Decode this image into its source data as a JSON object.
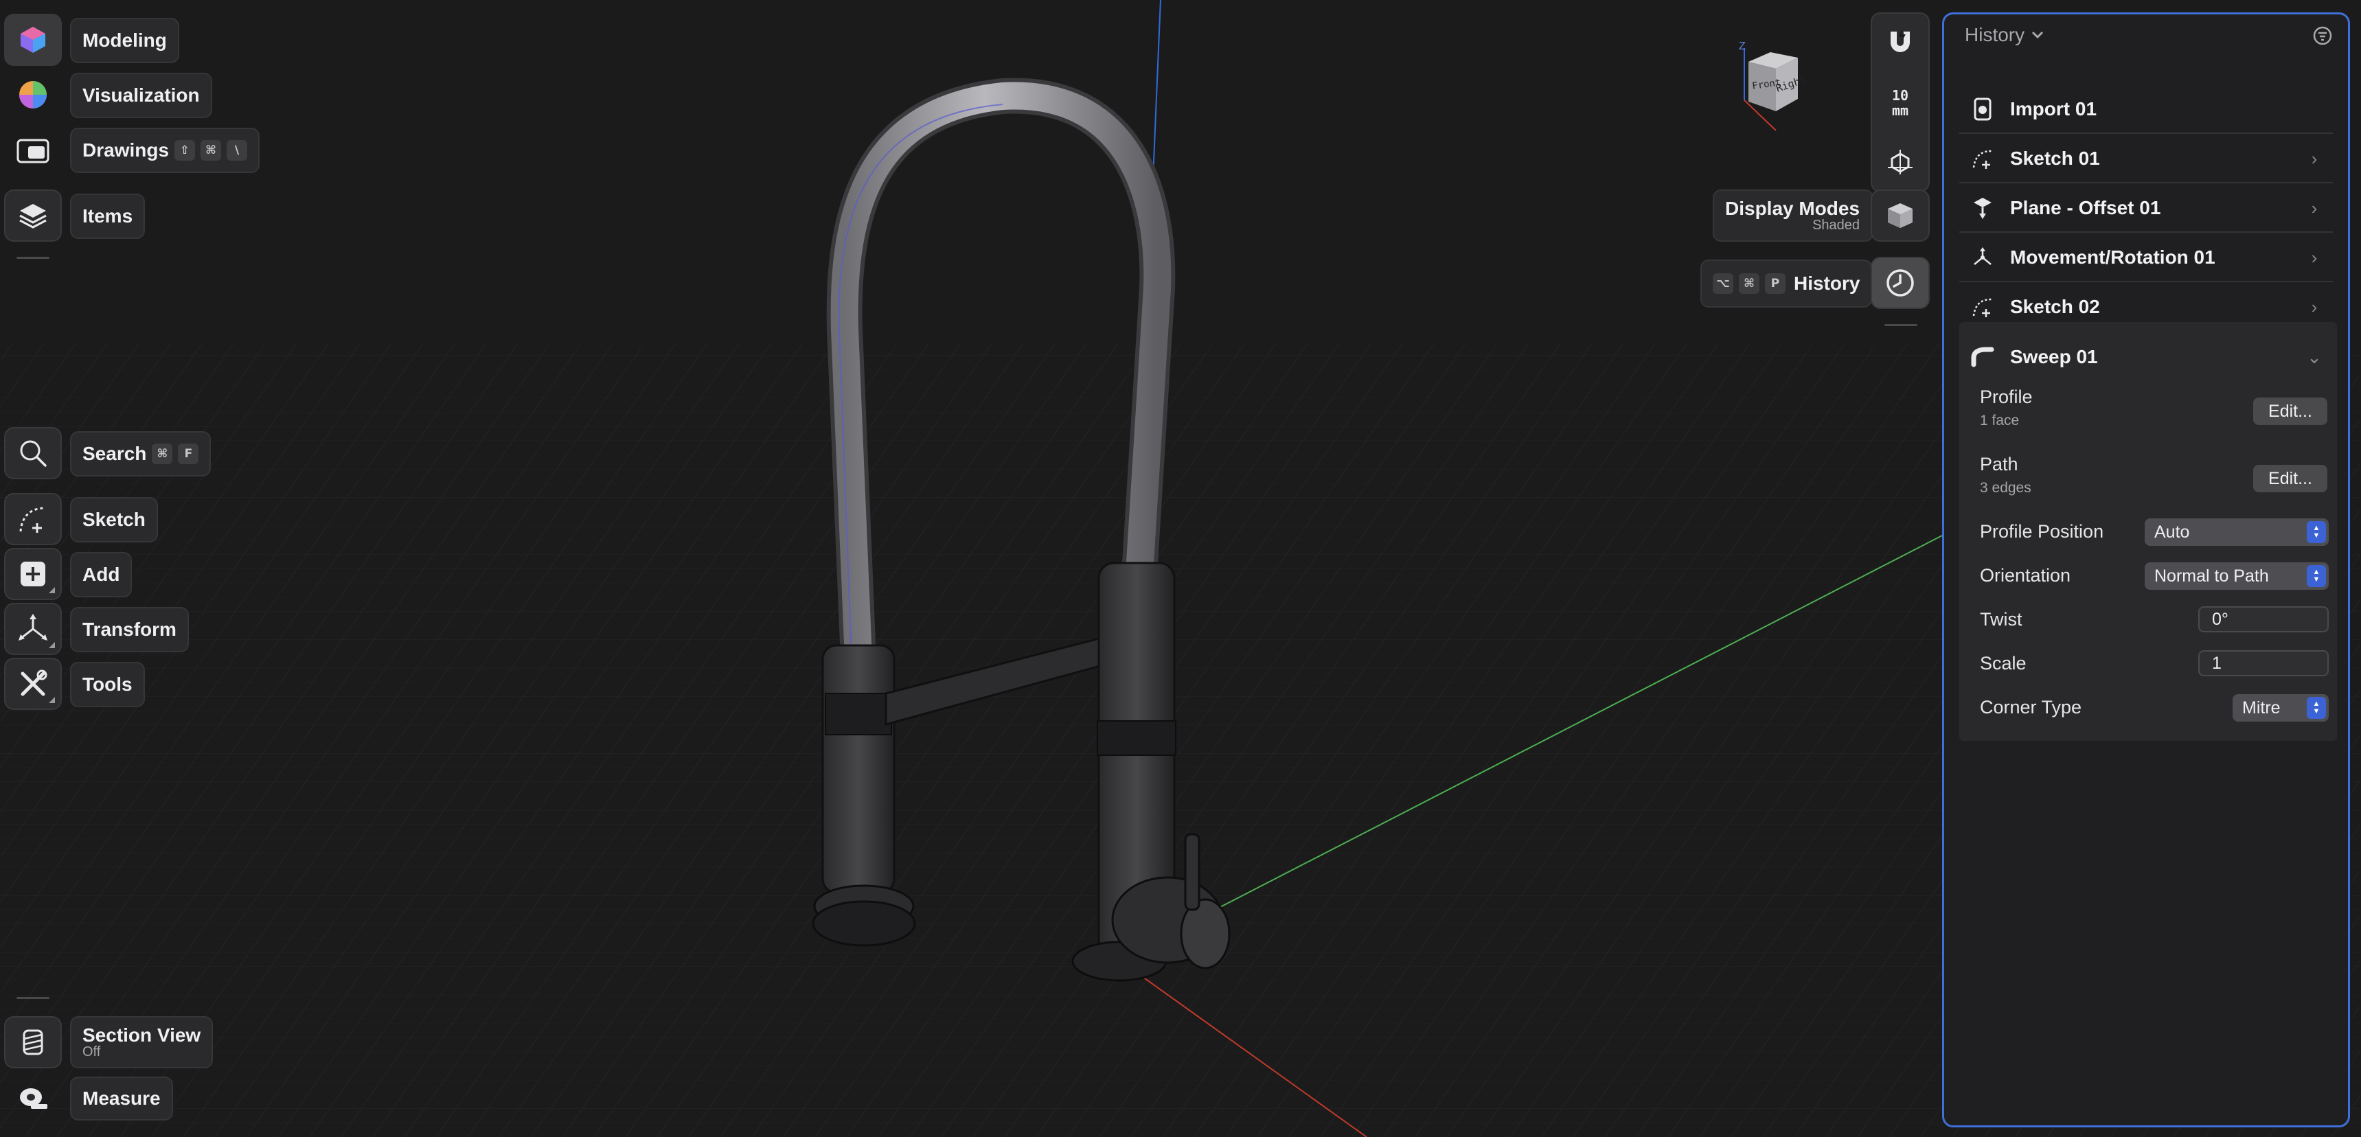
{
  "left_toolbar": {
    "modeling": "Modeling",
    "visualization": "Visualization",
    "drawings": "Drawings",
    "drawings_shortcut": [
      "⇧",
      "⌘",
      "\\"
    ],
    "items": "Items",
    "search": "Search",
    "search_shortcut": [
      "⌘",
      "F"
    ],
    "sketch": "Sketch",
    "add": "Add",
    "transform": "Transform",
    "tools": "Tools",
    "section_view": "Section View",
    "section_view_state": "Off",
    "measure": "Measure"
  },
  "right_toolbar": {
    "snap_value": "10",
    "snap_unit": "mm",
    "display_modes": "Display Modes",
    "display_mode_value": "Shaded",
    "history": "History",
    "history_shortcut": [
      "⌥",
      "⌘",
      "P"
    ],
    "view_cube_front": "Front",
    "view_cube_right": "Right",
    "view_cube_axis": "Z"
  },
  "history_panel": {
    "title": "History",
    "items": [
      {
        "label": "Import 01",
        "icon": "import-icon",
        "has_chevron": false
      },
      {
        "label": "Sketch 01",
        "icon": "sketch-icon",
        "has_chevron": true
      },
      {
        "label": "Plane - Offset 01",
        "icon": "plane-icon",
        "has_chevron": true
      },
      {
        "label": "Movement/Rotation 01",
        "icon": "move-rotate-icon",
        "has_chevron": true
      },
      {
        "label": "Sketch 02",
        "icon": "sketch-icon",
        "has_chevron": true
      },
      {
        "label": "Sweep 01",
        "icon": "sweep-icon",
        "has_chevron": true,
        "expanded": true
      }
    ],
    "sweep": {
      "profile_label": "Profile",
      "profile_value": "1 face",
      "path_label": "Path",
      "path_value": "3 edges",
      "edit_label": "Edit...",
      "profile_position_label": "Profile Position",
      "profile_position_value": "Auto",
      "orientation_label": "Orientation",
      "orientation_value": "Normal to Path",
      "twist_label": "Twist",
      "twist_value": "0°",
      "scale_label": "Scale",
      "scale_value": "1",
      "corner_type_label": "Corner Type",
      "corner_type_value": "Mitre"
    }
  },
  "colors": {
    "background": "#1b1b1c",
    "accent": "#3b63d6",
    "panel_border": "#3f6fd8",
    "axis_x": "#c0392b",
    "axis_y": "#4caf50",
    "axis_z": "#2f6bd8"
  }
}
